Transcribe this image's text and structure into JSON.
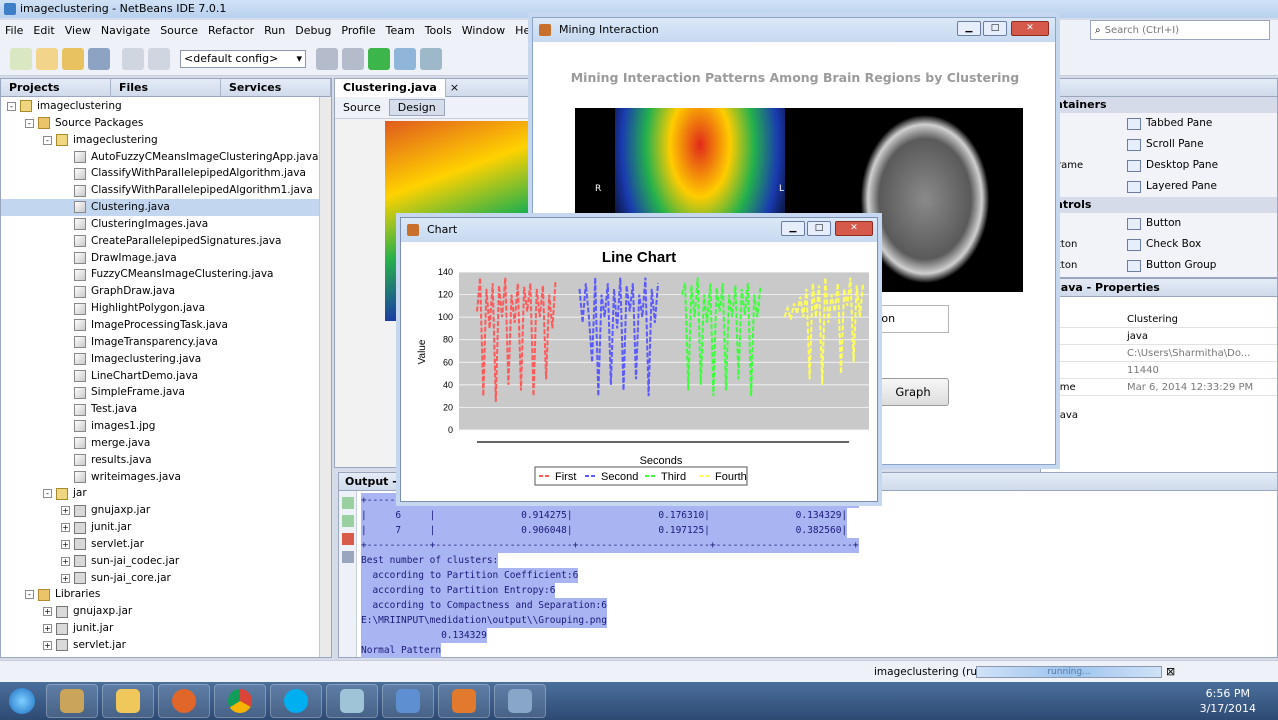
{
  "ide": {
    "title": "imageclustering - NetBeans IDE 7.0.1",
    "menu": [
      "File",
      "Edit",
      "View",
      "Navigate",
      "Source",
      "Refactor",
      "Run",
      "Debug",
      "Profile",
      "Team",
      "Tools",
      "Window",
      "Help"
    ],
    "config": "<default config>",
    "search_placeholder": "Search (Ctrl+I)"
  },
  "projects": {
    "tabs": [
      "Projects",
      "Files",
      "Services"
    ],
    "tree": [
      {
        "label": "imageclustering",
        "indent": 0,
        "icon": "project-icon",
        "expander": "-"
      },
      {
        "label": "Source Packages",
        "indent": 1,
        "icon": "folder-icon",
        "expander": "-"
      },
      {
        "label": "imageclustering",
        "indent": 2,
        "icon": "package-icon",
        "expander": "-"
      },
      {
        "label": "AutoFuzzyCMeansImageClusteringApp.java",
        "indent": 3,
        "icon": "java-file-icon"
      },
      {
        "label": "ClassifyWithParallelepipedAlgorithm.java",
        "indent": 3,
        "icon": "java-file-icon"
      },
      {
        "label": "ClassifyWithParallelepipedAlgorithm1.java",
        "indent": 3,
        "icon": "java-file-icon"
      },
      {
        "label": "Clustering.java",
        "indent": 3,
        "icon": "java-file-icon",
        "selected": true
      },
      {
        "label": "ClusteringImages.java",
        "indent": 3,
        "icon": "java-file-icon"
      },
      {
        "label": "CreateParallelepipedSignatures.java",
        "indent": 3,
        "icon": "java-file-icon"
      },
      {
        "label": "DrawImage.java",
        "indent": 3,
        "icon": "java-file-icon"
      },
      {
        "label": "FuzzyCMeansImageClustering.java",
        "indent": 3,
        "icon": "java-file-icon"
      },
      {
        "label": "GraphDraw.java",
        "indent": 3,
        "icon": "java-file-icon"
      },
      {
        "label": "HighlightPolygon.java",
        "indent": 3,
        "icon": "java-file-icon"
      },
      {
        "label": "ImageProcessingTask.java",
        "indent": 3,
        "icon": "java-file-icon"
      },
      {
        "label": "ImageTransparency.java",
        "indent": 3,
        "icon": "java-file-icon"
      },
      {
        "label": "Imageclustering.java",
        "indent": 3,
        "icon": "java-file-icon"
      },
      {
        "label": "LineChartDemo.java",
        "indent": 3,
        "icon": "java-file-icon"
      },
      {
        "label": "SimpleFrame.java",
        "indent": 3,
        "icon": "java-file-icon"
      },
      {
        "label": "Test.java",
        "indent": 3,
        "icon": "java-file-icon"
      },
      {
        "label": "images1.jpg",
        "indent": 3,
        "icon": "image-file-icon"
      },
      {
        "label": "merge.java",
        "indent": 3,
        "icon": "java-file-icon"
      },
      {
        "label": "results.java",
        "indent": 3,
        "icon": "java-file-icon"
      },
      {
        "label": "writeimages.java",
        "indent": 3,
        "icon": "java-file-icon"
      },
      {
        "label": "jar",
        "indent": 2,
        "icon": "package-icon",
        "expander": "-"
      },
      {
        "label": "gnujaxp.jar",
        "indent": 3,
        "icon": "jar-icon",
        "expander": "+"
      },
      {
        "label": "junit.jar",
        "indent": 3,
        "icon": "jar-icon",
        "expander": "+"
      },
      {
        "label": "servlet.jar",
        "indent": 3,
        "icon": "jar-icon",
        "expander": "+"
      },
      {
        "label": "sun-jai_codec.jar",
        "indent": 3,
        "icon": "jar-icon",
        "expander": "+"
      },
      {
        "label": "sun-jai_core.jar",
        "indent": 3,
        "icon": "jar-icon",
        "expander": "+"
      },
      {
        "label": "Libraries",
        "indent": 1,
        "icon": "folder-icon",
        "expander": "-"
      },
      {
        "label": "gnujaxp.jar",
        "indent": 2,
        "icon": "jar-icon",
        "expander": "+"
      },
      {
        "label": "junit.jar",
        "indent": 2,
        "icon": "jar-icon",
        "expander": "+"
      },
      {
        "label": "servlet.jar",
        "indent": 2,
        "icon": "jar-icon",
        "expander": "+"
      }
    ]
  },
  "editor": {
    "tab": "Clustering.java",
    "source_label": "Source",
    "design_label": "Design"
  },
  "output": {
    "title": "Output - im",
    "lines": [
      "+-----------+------------------------+-----------------------+------------------------+",
      "|     6     |               0.914275|               0.176310|               0.134329|",
      "|     7     |               0.906048|               0.197125|               0.382560|",
      "+-----------+------------------------+-----------------------+------------------------+",
      "Best number of clusters:",
      "  according to Partition Coefficient:6",
      "  according to Partition Entropy:6",
      "  according to Compactness and Separation:6",
      "E:\\MRIINPUT\\medidation\\output\\\\Grouping.png",
      "              0.134329",
      "Normal Pattern"
    ]
  },
  "palette": {
    "section1": "ntainers",
    "items1": [
      "Tabbed Pane",
      "Scroll Pane",
      "Desktop Pane",
      "Layered Pane"
    ],
    "left1": [
      "",
      "",
      "rame",
      ""
    ],
    "section2": "ntrols",
    "items2": [
      "Button",
      "Check Box",
      "Button Group"
    ],
    "left2": [
      "",
      "tton",
      "tton"
    ]
  },
  "properties": {
    "title": "java - Properties",
    "rows": [
      {
        "key": "",
        "value": "Clustering"
      },
      {
        "key": "",
        "value": "java"
      },
      {
        "key": "",
        "value": "C:\\Users\\Sharmitha\\Do..."
      },
      {
        "key": "",
        "value": "11440"
      },
      {
        "key": "ime",
        "value": "Mar 6, 2014 12:33:29 PM"
      }
    ],
    "footer": "java"
  },
  "mining": {
    "title": "Mining Interaction",
    "heading": "Mining Interaction Patterns Among Brain Regions by Clustering",
    "field_text": "tion",
    "graph_button": "Graph",
    "scan_left_R": "R",
    "scan_left_L": "L",
    "scan_right_L": "R"
  },
  "chart_window": {
    "title": "Chart"
  },
  "chart_data": {
    "type": "line",
    "title": "Line Chart",
    "xlabel": "Seconds",
    "ylabel": "Value",
    "ylim": [
      0,
      140
    ],
    "yticks": [
      0,
      20,
      40,
      60,
      80,
      100,
      120,
      140
    ],
    "grid": true,
    "legend_position": "bottom",
    "series": [
      {
        "name": "First",
        "color": "#ff5a5a",
        "values": [
          105,
          135,
          30,
          125,
          90,
          130,
          25,
          128,
          100,
          135,
          40,
          120,
          95,
          130,
          35,
          127,
          105,
          130,
          30,
          125,
          100,
          128,
          45,
          120,
          90,
          132
        ]
      },
      {
        "name": "Second",
        "color": "#5a5aff",
        "values": [
          125,
          95,
          130,
          100,
          60,
          135,
          30,
          120,
          100,
          130,
          40,
          125,
          90,
          135,
          35,
          128,
          105,
          130,
          45,
          120,
          100,
          135,
          30,
          125,
          95,
          130
        ]
      },
      {
        "name": "Third",
        "color": "#3cff3c",
        "values": [
          120,
          130,
          35,
          128,
          100,
          135,
          40,
          120,
          95,
          130,
          30,
          126,
          105,
          130,
          35,
          120,
          100,
          128,
          45,
          125,
          102,
          130,
          30,
          120,
          100,
          128
        ]
      },
      {
        "name": "Fourth",
        "color": "#ffff5a",
        "values": [
          100,
          108,
          98,
          112,
          103,
          118,
          100,
          125,
          45,
          130,
          100,
          128,
          40,
          135,
          95,
          120,
          105,
          130,
          50,
          125,
          110,
          135,
          60,
          128,
          100,
          130
        ]
      }
    ]
  },
  "status": {
    "project": "imageclustering (run)",
    "progress": "running..."
  },
  "taskbar": {
    "time": "6:56 PM",
    "date": "3/17/2014"
  }
}
